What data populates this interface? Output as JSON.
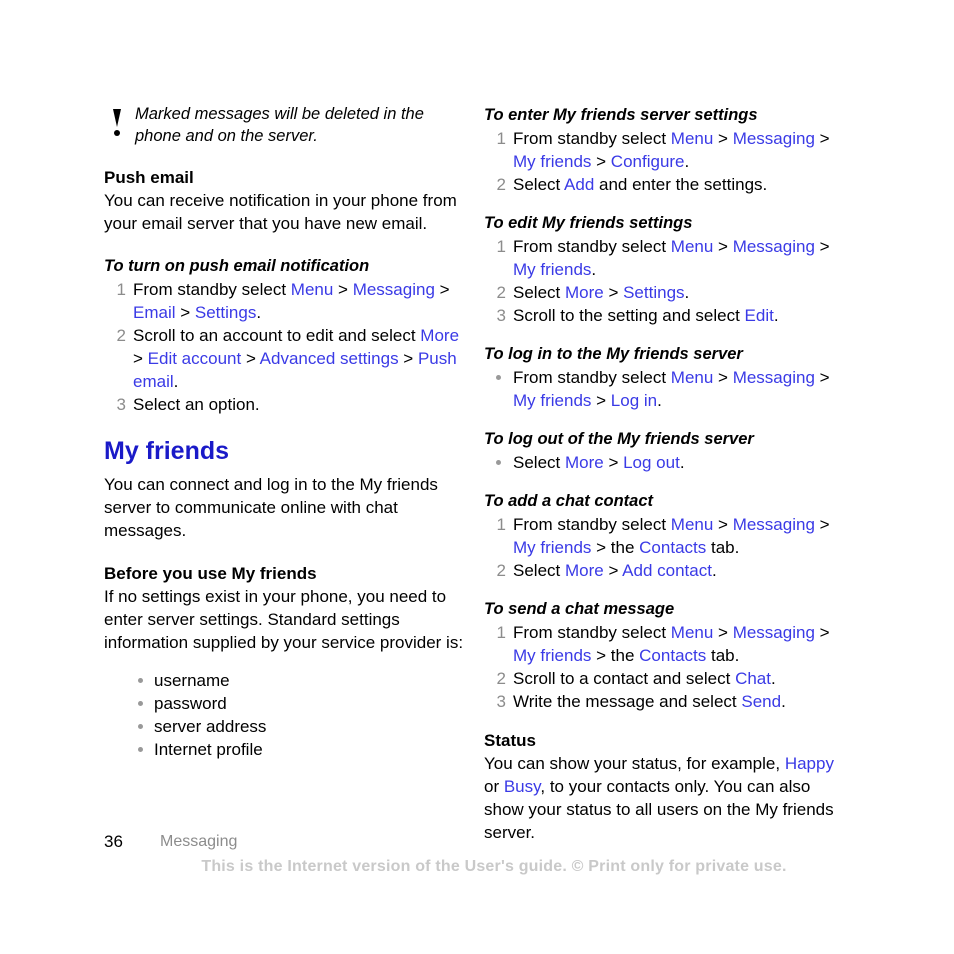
{
  "note": {
    "icon": "exclamation-icon",
    "text": "Marked messages will be deleted in the phone and on the server."
  },
  "left_column": {
    "push_email": {
      "heading": "Push email",
      "body": "You can receive notification in your phone from your email server that you have new email."
    },
    "proc_push_notification": {
      "heading": "To turn on push email notification",
      "steps": [
        {
          "num": "1",
          "parts": [
            {
              "t": "From standby select ",
              "k": "plain"
            },
            {
              "t": "Menu",
              "k": "link"
            },
            {
              "t": " > ",
              "k": "sep"
            },
            {
              "t": "Messaging",
              "k": "link"
            },
            {
              "t": " > ",
              "k": "sep"
            },
            {
              "t": "Email",
              "k": "link"
            },
            {
              "t": " > ",
              "k": "sep"
            },
            {
              "t": "Settings",
              "k": "link"
            },
            {
              "t": ".",
              "k": "plain"
            }
          ]
        },
        {
          "num": "2",
          "parts": [
            {
              "t": "Scroll to an account to edit and select ",
              "k": "plain"
            },
            {
              "t": "More",
              "k": "link"
            },
            {
              "t": " > ",
              "k": "sep"
            },
            {
              "t": "Edit account",
              "k": "link"
            },
            {
              "t": " > ",
              "k": "sep"
            },
            {
              "t": "Advanced settings",
              "k": "link"
            },
            {
              "t": " > ",
              "k": "sep"
            },
            {
              "t": "Push email",
              "k": "link"
            },
            {
              "t": ".",
              "k": "plain"
            }
          ]
        },
        {
          "num": "3",
          "parts": [
            {
              "t": "Select an option.",
              "k": "plain"
            }
          ]
        }
      ]
    },
    "my_friends": {
      "title": "My friends",
      "body": "You can connect and log in to the My friends server to communicate online with chat messages."
    },
    "before_use": {
      "heading": "Before you use My friends",
      "body": "If no settings exist in your phone, you need to enter server settings. Standard settings information supplied by your service provider is:",
      "bullets": [
        "username",
        "password",
        "server address",
        "Internet profile"
      ]
    }
  },
  "right_column": {
    "proc_enter_server": {
      "heading": "To enter My friends server settings",
      "steps": [
        {
          "num": "1",
          "parts": [
            {
              "t": "From standby select ",
              "k": "plain"
            },
            {
              "t": "Menu",
              "k": "link"
            },
            {
              "t": " > ",
              "k": "sep"
            },
            {
              "t": "Messaging",
              "k": "link"
            },
            {
              "t": " > ",
              "k": "sep"
            },
            {
              "t": "My friends",
              "k": "link"
            },
            {
              "t": " > ",
              "k": "sep"
            },
            {
              "t": "Configure",
              "k": "link"
            },
            {
              "t": ".",
              "k": "plain"
            }
          ]
        },
        {
          "num": "2",
          "parts": [
            {
              "t": "Select ",
              "k": "plain"
            },
            {
              "t": "Add",
              "k": "link"
            },
            {
              "t": " and enter the settings.",
              "k": "plain"
            }
          ]
        }
      ]
    },
    "proc_edit_settings": {
      "heading": "To edit My friends settings",
      "steps": [
        {
          "num": "1",
          "parts": [
            {
              "t": "From standby select ",
              "k": "plain"
            },
            {
              "t": "Menu",
              "k": "link"
            },
            {
              "t": " > ",
              "k": "sep"
            },
            {
              "t": "Messaging",
              "k": "link"
            },
            {
              "t": " > ",
              "k": "sep"
            },
            {
              "t": "My friends",
              "k": "link"
            },
            {
              "t": ".",
              "k": "plain"
            }
          ]
        },
        {
          "num": "2",
          "parts": [
            {
              "t": "Select ",
              "k": "plain"
            },
            {
              "t": "More",
              "k": "link"
            },
            {
              "t": " > ",
              "k": "sep"
            },
            {
              "t": "Settings",
              "k": "link"
            },
            {
              "t": ".",
              "k": "plain"
            }
          ]
        },
        {
          "num": "3",
          "parts": [
            {
              "t": "Scroll to the setting and select ",
              "k": "plain"
            },
            {
              "t": "Edit",
              "k": "link"
            },
            {
              "t": ".",
              "k": "plain"
            }
          ]
        }
      ]
    },
    "proc_log_in": {
      "heading": "To log in to the My friends server",
      "bullet_steps": [
        {
          "parts": [
            {
              "t": "From standby select ",
              "k": "plain"
            },
            {
              "t": "Menu",
              "k": "link"
            },
            {
              "t": " > ",
              "k": "sep"
            },
            {
              "t": "Messaging",
              "k": "link"
            },
            {
              "t": " > ",
              "k": "sep"
            },
            {
              "t": "My friends",
              "k": "link"
            },
            {
              "t": " > ",
              "k": "sep"
            },
            {
              "t": "Log in",
              "k": "link"
            },
            {
              "t": ".",
              "k": "plain"
            }
          ]
        }
      ]
    },
    "proc_log_out": {
      "heading": "To log out of the My friends server",
      "bullet_steps": [
        {
          "parts": [
            {
              "t": "Select ",
              "k": "plain"
            },
            {
              "t": "More",
              "k": "link"
            },
            {
              "t": " > ",
              "k": "sep"
            },
            {
              "t": "Log out",
              "k": "link"
            },
            {
              "t": ".",
              "k": "plain"
            }
          ]
        }
      ]
    },
    "proc_add_contact": {
      "heading": "To add a chat contact",
      "steps": [
        {
          "num": "1",
          "parts": [
            {
              "t": "From standby select ",
              "k": "plain"
            },
            {
              "t": "Menu",
              "k": "link"
            },
            {
              "t": " > ",
              "k": "sep"
            },
            {
              "t": "Messaging",
              "k": "link"
            },
            {
              "t": " > ",
              "k": "sep"
            },
            {
              "t": "My friends",
              "k": "link"
            },
            {
              "t": " > the ",
              "k": "sep"
            },
            {
              "t": "Contacts",
              "k": "link"
            },
            {
              "t": " tab.",
              "k": "plain"
            }
          ]
        },
        {
          "num": "2",
          "parts": [
            {
              "t": "Select ",
              "k": "plain"
            },
            {
              "t": "More",
              "k": "link"
            },
            {
              "t": " > ",
              "k": "sep"
            },
            {
              "t": "Add contact",
              "k": "link"
            },
            {
              "t": ".",
              "k": "plain"
            }
          ]
        }
      ]
    },
    "proc_send_message": {
      "heading": "To send a chat message",
      "steps": [
        {
          "num": "1",
          "parts": [
            {
              "t": "From standby select ",
              "k": "plain"
            },
            {
              "t": "Menu",
              "k": "link"
            },
            {
              "t": " > ",
              "k": "sep"
            },
            {
              "t": "Messaging",
              "k": "link"
            },
            {
              "t": " > ",
              "k": "sep"
            },
            {
              "t": "My friends",
              "k": "link"
            },
            {
              "t": " > the ",
              "k": "sep"
            },
            {
              "t": "Contacts",
              "k": "link"
            },
            {
              "t": " tab.",
              "k": "plain"
            }
          ]
        },
        {
          "num": "2",
          "parts": [
            {
              "t": "Scroll to a contact and select ",
              "k": "plain"
            },
            {
              "t": "Chat",
              "k": "link"
            },
            {
              "t": ".",
              "k": "plain"
            }
          ]
        },
        {
          "num": "3",
          "parts": [
            {
              "t": "Write the message and select ",
              "k": "plain"
            },
            {
              "t": "Send",
              "k": "link"
            },
            {
              "t": ".",
              "k": "plain"
            }
          ]
        }
      ]
    },
    "status": {
      "heading": "Status",
      "parts": [
        {
          "t": "You can show your status, for example, ",
          "k": "plain"
        },
        {
          "t": "Happy",
          "k": "link"
        },
        {
          "t": " or ",
          "k": "plain"
        },
        {
          "t": "Busy",
          "k": "link"
        },
        {
          "t": ", to your contacts only. You can also show your status to all users on the My friends server.",
          "k": "plain"
        }
      ]
    }
  },
  "footer": {
    "page_number": "36",
    "chapter": "Messaging",
    "copyright": "This is the Internet version of the User's guide. © Print only for private use."
  },
  "colors": {
    "link_blue": "#3a3ae6",
    "heading_blue": "#1a1ac8",
    "step_number_gray": "#8c8c8c",
    "bullet_gray": "#999999",
    "footer_gray": "#8c8c8c",
    "copyright_gray": "#c9c9c9"
  }
}
